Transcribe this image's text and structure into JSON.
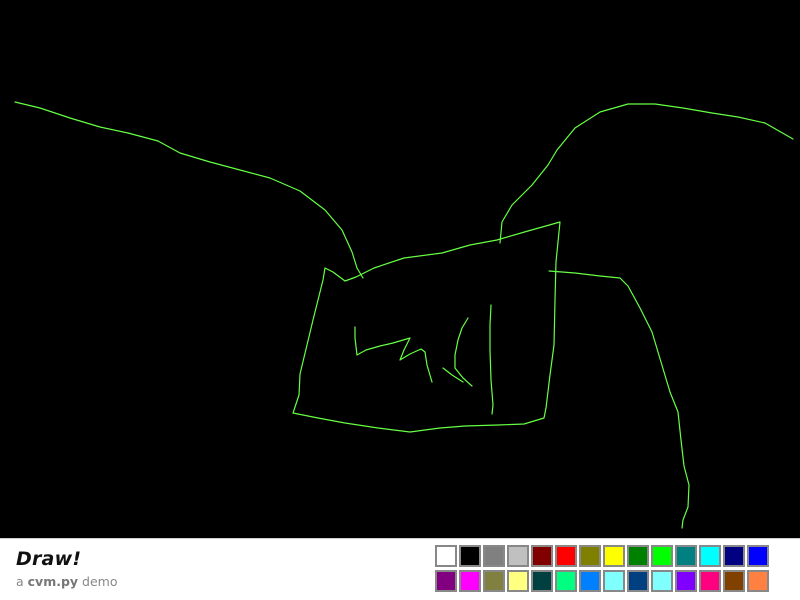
{
  "app": {
    "title": "Draw!",
    "subtitle_prefix": "a ",
    "subtitle_lib": "cvm.py",
    "subtitle_suffix": " demo"
  },
  "canvas": {
    "background": "#000000",
    "stroke_color": "#66ff44"
  },
  "palette": {
    "selected_color": "#66ff44",
    "colors": [
      "#ffffff",
      "#000000",
      "#808080",
      "#c0c0c0",
      "#800000",
      "#ff0000",
      "#808000",
      "#ffff00",
      "#008000",
      "#00ff00",
      "#008080",
      "#00ffff",
      "#000080",
      "#0000ff",
      "#800080",
      "#ff00ff",
      "#808040",
      "#ffff80",
      "#004040",
      "#00ff80",
      "#0080ff",
      "#80ffff",
      "#004080",
      "#80ffff",
      "#8000ff",
      "#ff0080",
      "#804000",
      "#ff8040"
    ]
  }
}
